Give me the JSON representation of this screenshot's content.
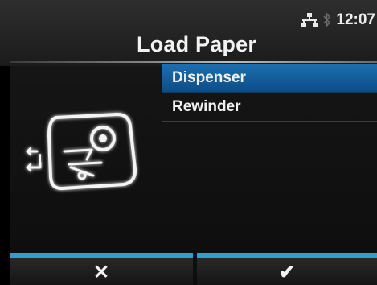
{
  "status": {
    "time": "12:07",
    "network_icon": "network-icon",
    "bluetooth_icon": "bluetooth-icon"
  },
  "screen": {
    "title": "Load Paper"
  },
  "menu": {
    "items": [
      {
        "label": "Dispenser",
        "selected": true
      },
      {
        "label": "Rewinder",
        "selected": false
      }
    ]
  },
  "softkeys": {
    "cancel_glyph": "✕",
    "confirm_glyph": "✔"
  },
  "colors": {
    "accent": "#2a9fd8",
    "selected": "#1b6fb0"
  }
}
